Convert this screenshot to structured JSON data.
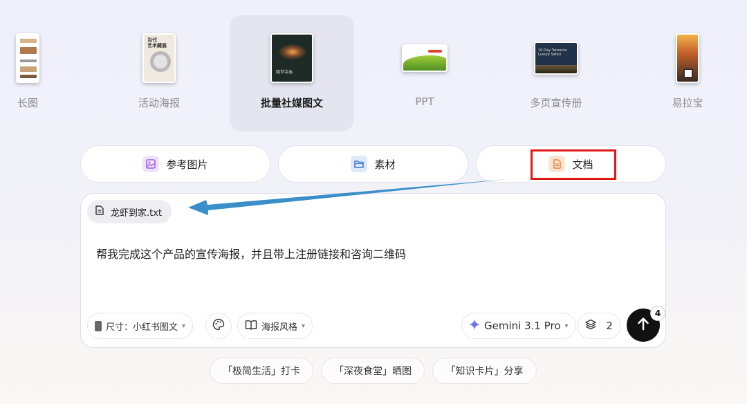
{
  "types": [
    {
      "label": "长图"
    },
    {
      "label": "活动海报",
      "thumb_text": "当代\n艺术藏展"
    },
    {
      "label": "批量社媒图文",
      "thumb_text": "隐世寺庙"
    },
    {
      "label": "PPT"
    },
    {
      "label": "多页宣传册",
      "thumb_text": "10-Day Tanzania\nLuxury Safari"
    },
    {
      "label": "易拉宝"
    }
  ],
  "attach_tabs": {
    "reference": "参考图片",
    "material": "素材",
    "document": "文档"
  },
  "composer": {
    "file_name": "龙虾到家.txt",
    "prompt": "帮我完成这个产品的宣传海报，并且带上注册链接和咨询二维码",
    "size_label": "尺寸：小红书图文",
    "style_label": "海报风格",
    "model_label": "Gemini 3.1 Pro",
    "layers_count": "2",
    "send_badge": "4"
  },
  "suggestions": [
    "「极简生活」打卡",
    "「深夜食堂」晒图",
    "「知识卡片」分享"
  ],
  "colors": {
    "highlight": "#e01818",
    "arrow": "#3b8fc8",
    "reference_icon": "#9b5de5",
    "material_icon": "#3a7bd5",
    "document_icon": "#e8833a"
  }
}
